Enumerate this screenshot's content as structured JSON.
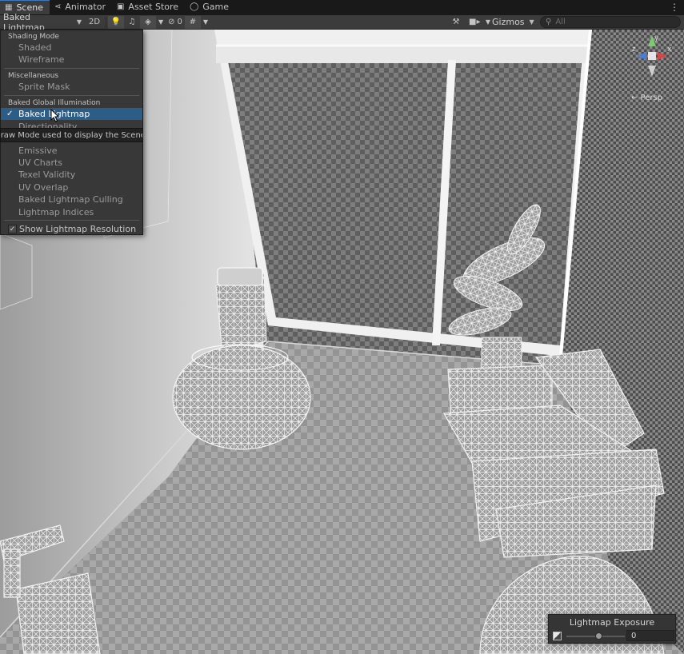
{
  "tabs": [
    {
      "label": "Scene",
      "icon": "grid-icon",
      "active": true
    },
    {
      "label": "Animator",
      "icon": "animator-icon",
      "active": false
    },
    {
      "label": "Asset Store",
      "icon": "store-icon",
      "active": false
    },
    {
      "label": "Game",
      "icon": "gamepad-icon",
      "active": false
    }
  ],
  "toolbar": {
    "draw_mode": "Baked Lightmap",
    "btn_2d": "2D",
    "hidden_count": "0",
    "gizmos_label": "Gizmos",
    "search_placeholder": "All"
  },
  "menu": {
    "header_shading": "Shading Mode",
    "shaded": "Shaded",
    "wireframe": "Wireframe",
    "header_misc": "Miscellaneous",
    "sprite_mask": "Sprite Mask",
    "header_gi": "Baked Global Illumination",
    "baked_lightmap": "Baked Lightmap",
    "directionality": "Directionality",
    "emissive": "Emissive",
    "uv_charts": "UV Charts",
    "texel_validity": "Texel Validity",
    "uv_overlap": "UV Overlap",
    "baked_lightmap_culling": "Baked Lightmap Culling",
    "lightmap_indices": "Lightmap Indices",
    "show_lightmap_resolution": "Show Lightmap Resolution",
    "show_lightmap_resolution_checked": true,
    "selected": "Baked Lightmap"
  },
  "tooltip": "Draw Mode used to display the Scene.",
  "gizmo": {
    "persp_label": "← Persp",
    "axis_y": "y",
    "axis_x": "x",
    "axis_z": "z"
  },
  "exposure": {
    "title": "Lightmap Exposure",
    "value": "0",
    "slider_fraction": 0.55
  },
  "colors": {
    "accent": "#3a79bb",
    "selection": "#2c5d87",
    "panel": "#383838"
  }
}
